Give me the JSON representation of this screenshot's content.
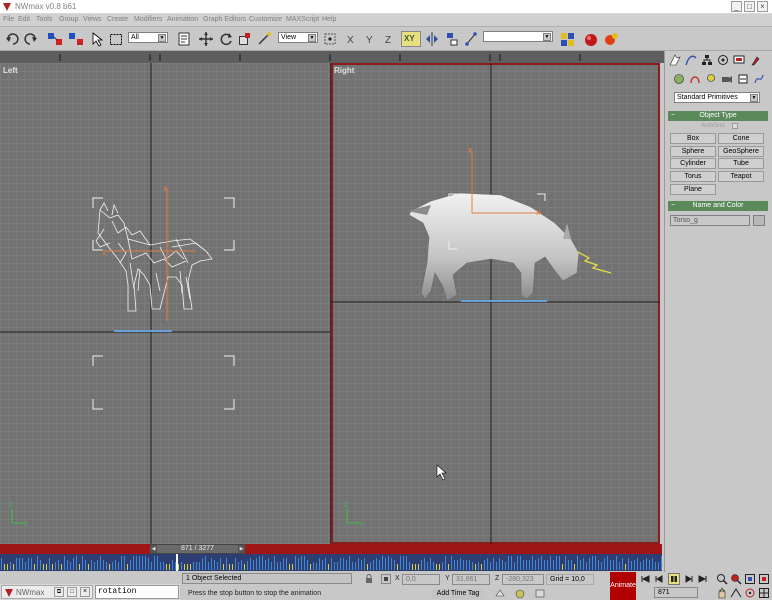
{
  "window": {
    "title": "NWmax v0.8 b61",
    "controls": [
      "minimize-icon",
      "maximize-icon",
      "close-icon"
    ]
  },
  "menu": {
    "items": [
      "File",
      "Edit",
      "Tools",
      "Group",
      "Views",
      "Create",
      "Modifiers",
      "Animation",
      "Graph Editors",
      "Customize",
      "MAXScript",
      "Help"
    ]
  },
  "toolbar": {
    "selection_filter": "All",
    "reference_coord": "View",
    "named_selection": "",
    "axis_constraint": "XY"
  },
  "viewports": {
    "left_label": "Left",
    "right_label": "Right"
  },
  "time_slider": {
    "frame_display": "871 / 3277",
    "current_frame": 871,
    "total_frames": 3277
  },
  "command_panel": {
    "category": "Standard Primitives",
    "object_type_header": "Object Type",
    "autogrid": "AutoGrid",
    "buttons": [
      "Box",
      "Cone",
      "Sphere",
      "GeoSphere",
      "Cylinder",
      "Tube",
      "Torus",
      "Teapot",
      "Plane"
    ],
    "name_color_header": "Name and Color",
    "object_name": "Torso_g",
    "object_color": "#b8b8b8"
  },
  "status_bar": {
    "selection": "1 Object Selected",
    "prompt": "Press the stop button to stop the animation",
    "x_label": "X",
    "x_value": "0,0",
    "y_label": "Y",
    "y_value": "31,861",
    "z_label": "Z",
    "z_value": "-280,323",
    "grid": "Grid = 10,0",
    "add_time_tag": "Add Time Tag",
    "animate_label": "Animate",
    "frame_field": "871"
  },
  "taskbar": {
    "app_label": "NWmax",
    "script_input": "rotation"
  },
  "colors": {
    "viewport_bg": "#727272",
    "active_border": "#8a1c1c",
    "rollout_header": "#5a8a5a",
    "animate_button": "#b00000",
    "time_slider": "#a01515",
    "selection_gizmo": "#e08040"
  }
}
